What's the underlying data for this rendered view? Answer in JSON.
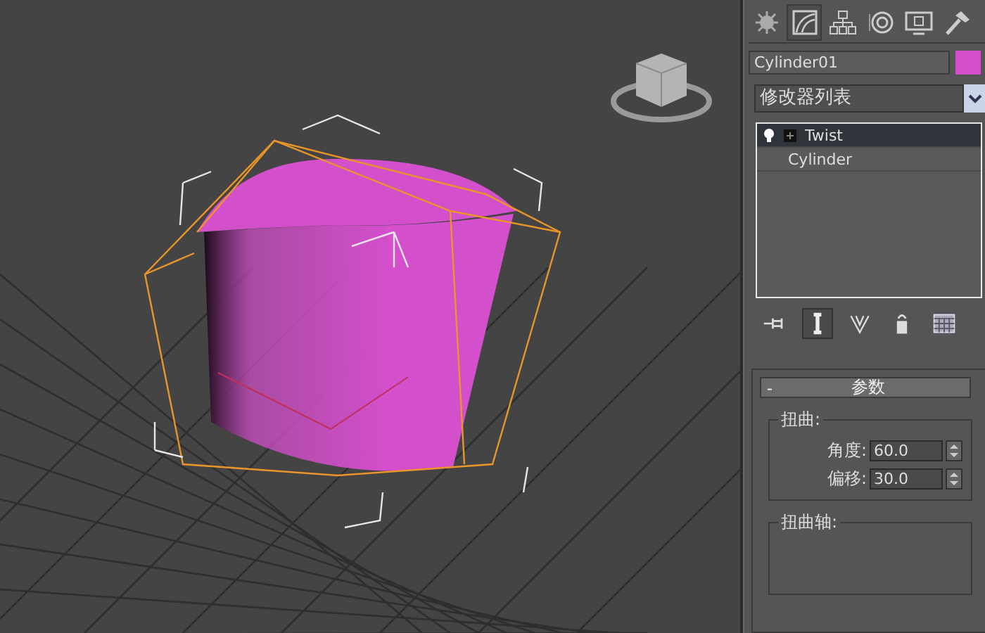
{
  "command_tabs": [
    {
      "kind": "create",
      "selected": false
    },
    {
      "kind": "modify",
      "selected": true
    },
    {
      "kind": "hierarchy",
      "selected": false
    },
    {
      "kind": "motion",
      "selected": false
    },
    {
      "kind": "display",
      "selected": false
    },
    {
      "kind": "utilities",
      "selected": false
    }
  ],
  "object_name": "Cylinder01",
  "modifier_list": {
    "label": "修改器列表"
  },
  "modifier_stack": [
    {
      "label": "Twist",
      "kind": "modifier",
      "selected": true
    },
    {
      "label": "Cylinder",
      "kind": "base",
      "selected": false
    }
  ],
  "stack_tools": [
    {
      "kind": "pin",
      "selected": false
    },
    {
      "kind": "show-end-result",
      "selected": true
    },
    {
      "kind": "make-unique",
      "selected": false
    },
    {
      "kind": "remove",
      "selected": false
    },
    {
      "kind": "configure",
      "selected": false
    }
  ],
  "rollout": {
    "toggle": "-",
    "title": "参数",
    "groups": [
      {
        "title": "扭曲:",
        "fields": [
          {
            "label": "角度:",
            "value": "60.0"
          },
          {
            "label": "偏移:",
            "value": "30.0"
          }
        ]
      },
      {
        "title": "扭曲轴:"
      }
    ]
  }
}
